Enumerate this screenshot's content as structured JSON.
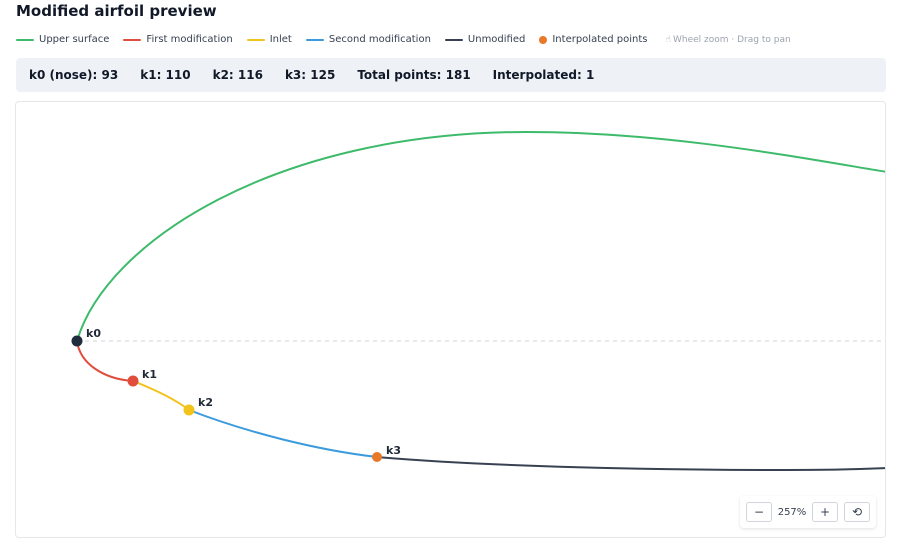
{
  "header": {
    "title": "Modified airfoil preview"
  },
  "legend": {
    "items": [
      {
        "label": "Upper surface",
        "color": "#3dba6a",
        "kind": "line"
      },
      {
        "label": "First modification",
        "color": "#e14d3c",
        "kind": "line"
      },
      {
        "label": "Inlet",
        "color": "#f2c31b",
        "kind": "line"
      },
      {
        "label": "Second modification",
        "color": "#3b9bdc",
        "kind": "line"
      },
      {
        "label": "Unmodified",
        "color": "#374151",
        "kind": "line"
      },
      {
        "label": "Interpolated points",
        "color": "#e8792a",
        "kind": "dot"
      }
    ],
    "hint_icon": "hand-icon",
    "hint": "Wheel zoom · Drag to pan"
  },
  "stats": {
    "k0": "k0 (nose): 93",
    "k1": "k1: 110",
    "k2": "k2: 116",
    "k3": "k3: 125",
    "total": "Total points: 181",
    "interpolated": "Interpolated: 1"
  },
  "points": {
    "k0": {
      "label": "k0",
      "color": "#1f2d3d"
    },
    "k1": {
      "label": "k1",
      "color": "#e14d3c"
    },
    "k2": {
      "label": "k2",
      "color": "#f2c31b"
    },
    "k3": {
      "label": "k3",
      "color": "#e8792a"
    }
  },
  "zoom": {
    "minus": "−",
    "level": "257%",
    "plus": "+",
    "reset": "⟲",
    "reset_icon": "reset-icon"
  }
}
